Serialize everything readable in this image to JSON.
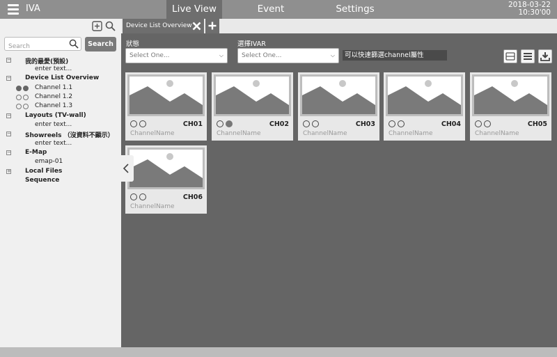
{
  "app": {
    "title": "IVA"
  },
  "nav": {
    "tabs": [
      {
        "label": "Live View",
        "active": true
      },
      {
        "label": "Event",
        "active": false
      },
      {
        "label": "Settings",
        "active": false
      }
    ]
  },
  "datetime": {
    "date": "2018-03-22",
    "time": "10:30'00"
  },
  "sidebar": {
    "search": {
      "placeholder": "Search",
      "button": "Search"
    },
    "tree": [
      {
        "label": "我的最愛(預設)",
        "bold": true
      },
      {
        "label": "enter text...",
        "bold": false
      },
      {
        "label": "Device List Overview",
        "bold": true
      },
      {
        "label": "Channel 1.1",
        "bold": false
      },
      {
        "label": "Channel 1.2",
        "bold": false
      },
      {
        "label": "Channel 1.3",
        "bold": false
      },
      {
        "label": "Layouts (TV-wall)",
        "bold": true
      },
      {
        "label": "enter text...",
        "bold": false
      },
      {
        "label": "Showreels （沒資料不顯示）",
        "bold": true
      },
      {
        "label": "enter text...",
        "bold": false
      },
      {
        "label": "E-Map",
        "bold": true
      },
      {
        "label": "emap-01",
        "bold": false
      },
      {
        "label": "Local Files",
        "bold": true
      },
      {
        "label": "Sequence",
        "bold": true
      }
    ]
  },
  "main": {
    "tab": {
      "label": "Device List Overview"
    },
    "filters": {
      "status_label": "狀態",
      "status_placeholder": "Select One...",
      "ivar_label": "選擇IVAR",
      "ivar_placeholder": "Select One...",
      "hint": "可以快速篩選channel屬性"
    },
    "cards": [
      {
        "channel": "CH01",
        "name": "ChannelName",
        "status": [
          false,
          false
        ]
      },
      {
        "channel": "CH02",
        "name": "ChannelName",
        "status": [
          false,
          true
        ]
      },
      {
        "channel": "CH03",
        "name": "ChannelName",
        "status": [
          false,
          false
        ]
      },
      {
        "channel": "CH04",
        "name": "ChannelName",
        "status": [
          false,
          false
        ]
      },
      {
        "channel": "CH05",
        "name": "ChannelName",
        "status": [
          false,
          false
        ]
      },
      {
        "channel": "CH06",
        "name": "ChannelName",
        "status": [
          false,
          false
        ]
      }
    ]
  },
  "colors": {
    "topbar": "#8f8f8f",
    "main_bg": "#656565",
    "sidebar_bg": "#f0f0f0"
  }
}
